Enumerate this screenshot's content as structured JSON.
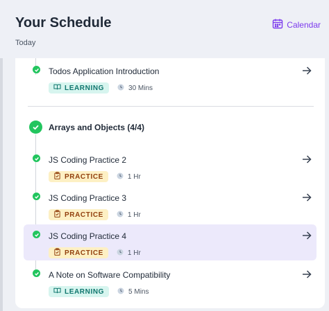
{
  "header": {
    "title": "Your Schedule",
    "subtitle": "Today",
    "calendar_label": "Calendar"
  },
  "colors": {
    "accent": "#7c3aed",
    "complete": "#22c55e",
    "learning_bg": "#d7f5ef",
    "practice_bg": "#fdf0c4",
    "active_bg": "#ece9fb"
  },
  "icons": {
    "calendar": "calendar-icon",
    "arrow": "arrow-right-icon",
    "learning": "book-icon",
    "practice": "clipboard-icon",
    "duration": "clock-icon",
    "check": "check-icon"
  },
  "first_item": {
    "title": "Todos Application Introduction",
    "badge": "LEARNING",
    "duration": "30 Mins"
  },
  "section": {
    "title": "Arrays and Objects (4/4)"
  },
  "items": [
    {
      "title": "JS Coding Practice 2",
      "badge": "PRACTICE",
      "duration": "1 Hr"
    },
    {
      "title": "JS Coding Practice 3",
      "badge": "PRACTICE",
      "duration": "1 Hr"
    },
    {
      "title": "JS Coding Practice 4",
      "badge": "PRACTICE",
      "duration": "1 Hr"
    },
    {
      "title": "A Note on Software Compatibility",
      "badge": "LEARNING",
      "duration": "5 Mins"
    }
  ]
}
